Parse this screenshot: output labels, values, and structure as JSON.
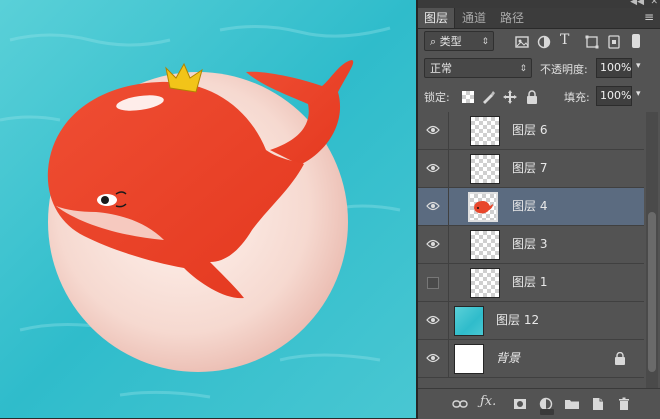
{
  "panel": {
    "tabs": [
      {
        "label": "图层",
        "active": true
      },
      {
        "label": "通道",
        "active": false
      },
      {
        "label": "路径",
        "active": false
      }
    ],
    "filter": {
      "label": "类型",
      "icon": "search-icon"
    },
    "blend_mode": "正常",
    "opacity_label": "不透明度:",
    "opacity_value": "100%",
    "lock_label": "锁定:",
    "fill_label": "填充:",
    "fill_value": "100%"
  },
  "layers": [
    {
      "name": "图层 6",
      "visible": true,
      "thumb": "transparent",
      "selected": false
    },
    {
      "name": "图层 7",
      "visible": true,
      "thumb": "transparent",
      "selected": false
    },
    {
      "name": "图层 4",
      "visible": true,
      "thumb": "whale",
      "selected": true
    },
    {
      "name": "图层 3",
      "visible": true,
      "thumb": "transparent",
      "selected": false
    },
    {
      "name": "图层 1",
      "visible": false,
      "thumb": "transparent",
      "selected": false
    },
    {
      "name": "图层 12",
      "visible": true,
      "thumb": "water",
      "selected": false
    },
    {
      "name": "背景",
      "visible": true,
      "thumb": "white",
      "selected": false,
      "locked": true
    }
  ],
  "colors": {
    "panel_bg": "#535353",
    "selected_row": "#5b6b80",
    "whale_red": "#e8472c",
    "water": "#3fc3d0"
  }
}
